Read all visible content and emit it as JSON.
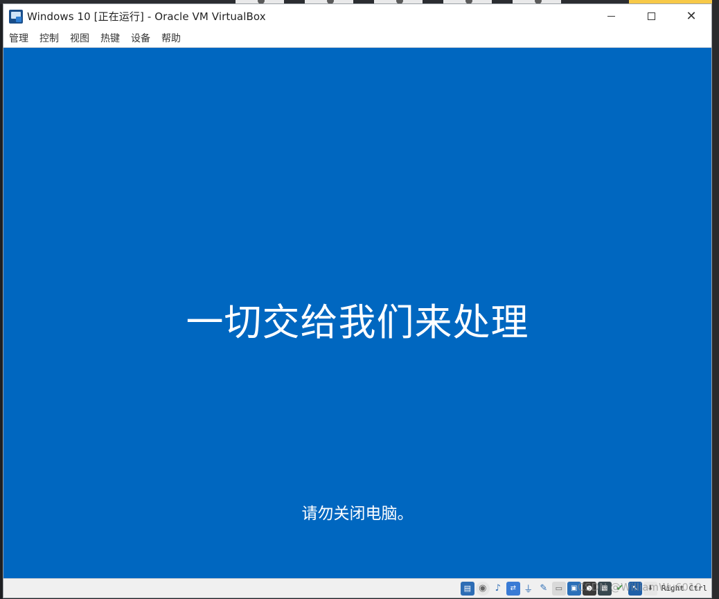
{
  "window": {
    "title": "Windows 10 [正在运行] - Oracle VM VirtualBox",
    "controls": {
      "minimize": "minimize",
      "maximize": "maximize",
      "close": "✕"
    }
  },
  "menubar": {
    "items": [
      {
        "label": "管理"
      },
      {
        "label": "控制"
      },
      {
        "label": "视图"
      },
      {
        "label": "热键"
      },
      {
        "label": "设备"
      },
      {
        "label": "帮助"
      }
    ]
  },
  "vm_screen": {
    "heading": "一切交给我们来处理",
    "subtext": "请勿关闭电脑。",
    "background_color": "#0067c0"
  },
  "statusbar": {
    "icons": [
      "hard-disk-icon",
      "optical-drive-icon",
      "audio-icon",
      "network-icon",
      "usb-icon",
      "shared-clipboard-icon",
      "shared-folder-icon",
      "display-icon",
      "recording-icon",
      "cpu-icon",
      "vt-x-icon",
      "mouse-integration-icon",
      "keyboard-capture-icon"
    ],
    "host_key": "Right Ctrl",
    "watermark": "CSDN @WilliamWu6010"
  }
}
